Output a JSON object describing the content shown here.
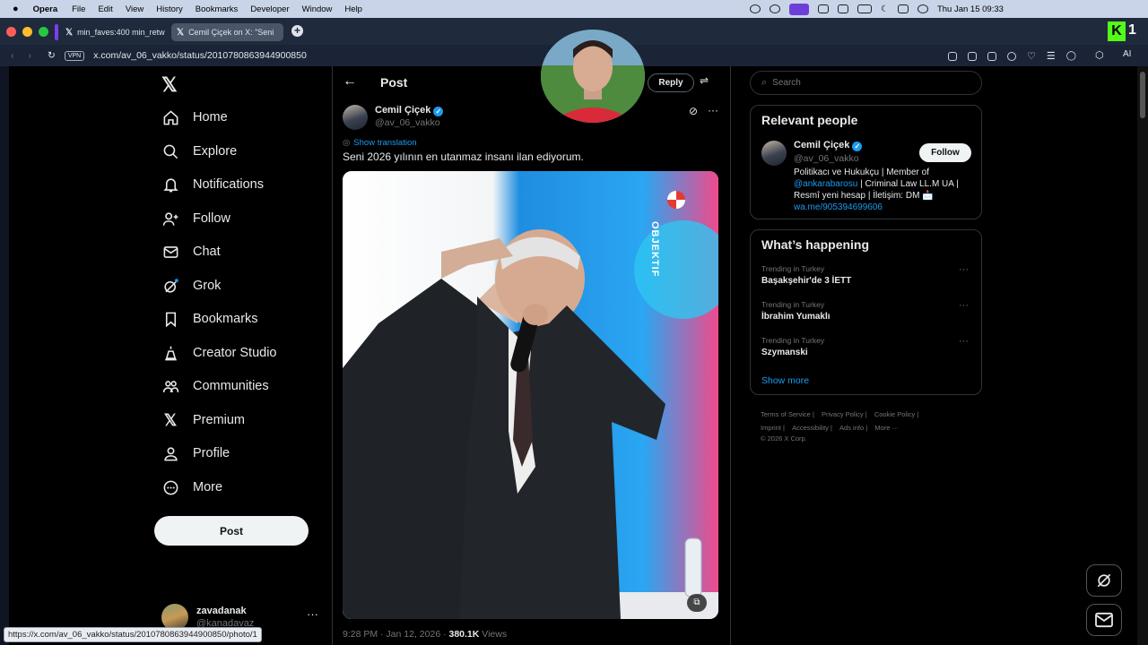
{
  "os_menu": {
    "app": "Opera",
    "items": [
      "File",
      "Edit",
      "View",
      "History",
      "Bookmarks",
      "Developer",
      "Window",
      "Help"
    ],
    "clock": "Thu Jan 15  09:33"
  },
  "tabs": [
    {
      "title": "min_faves:400 min_retw"
    },
    {
      "title": "Cemil Çiçek on X: \"Seni"
    }
  ],
  "address": {
    "vpn": "VPN",
    "url": "x.com/av_06_vakko/status/2010780863944900850",
    "ai": "AI"
  },
  "nav": {
    "home": "Home",
    "explore": "Explore",
    "notifications": "Notifications",
    "follow": "Follow",
    "chat": "Chat",
    "grok": "Grok",
    "bookmarks": "Bookmarks",
    "creator_studio": "Creator Studio",
    "communities": "Communities",
    "premium": "Premium",
    "profile": "Profile",
    "more": "More",
    "post_button": "Post"
  },
  "account": {
    "name": "zavadanak",
    "handle": "@kanadavaz"
  },
  "main": {
    "header_title": "Post",
    "reply_label": "Reply",
    "author": {
      "name": "Cemil Çiçek",
      "handle": "@av_06_vakko"
    },
    "show_translation": "Show translation",
    "text": "Seni 2026 yılının en utanmaz insanı ilan ediyorum.",
    "watermark": "OBJEKTIF",
    "meta": {
      "time": "9:28 PM · Jan 12, 2026 · ",
      "views_count": "380.1K",
      "views_label": " Views"
    }
  },
  "search": {
    "placeholder": "Search"
  },
  "relevant": {
    "title": "Relevant people",
    "name": "Cemil Çiçek",
    "handle": "@av_06_vakko",
    "follow_label": "Follow",
    "bio_1": "Politikacı ve Hukukçu | Member of",
    "bio_mention": "@ankarabarosu",
    "bio_2": " | Criminal Law LL.M UA | Resmî yeni hesap | İletişim: DM 📩",
    "bio_link": "wa.me/905394699606"
  },
  "happening": {
    "title": "What’s happening",
    "trends": [
      {
        "context": "Trending in Turkey",
        "name": "Başakşehir'de 3 İETT"
      },
      {
        "context": "Trending in Turkey",
        "name": "İbrahim Yumaklı"
      },
      {
        "context": "Trending in Turkey",
        "name": "Szymanski"
      }
    ],
    "show_more": "Show more"
  },
  "footer": {
    "links": [
      "Terms of Service",
      "Privacy Policy",
      "Cookie Policy",
      "Imprint",
      "Accessibility",
      "Ads info",
      "More ···"
    ],
    "copyright": "© 2026 X Corp."
  },
  "status_url": "https://x.com/av_06_vakko/status/2010780863944900850/photo/1",
  "colors": {
    "accent": "#1d9bf0",
    "background": "#000000",
    "border": "#2f3336"
  }
}
